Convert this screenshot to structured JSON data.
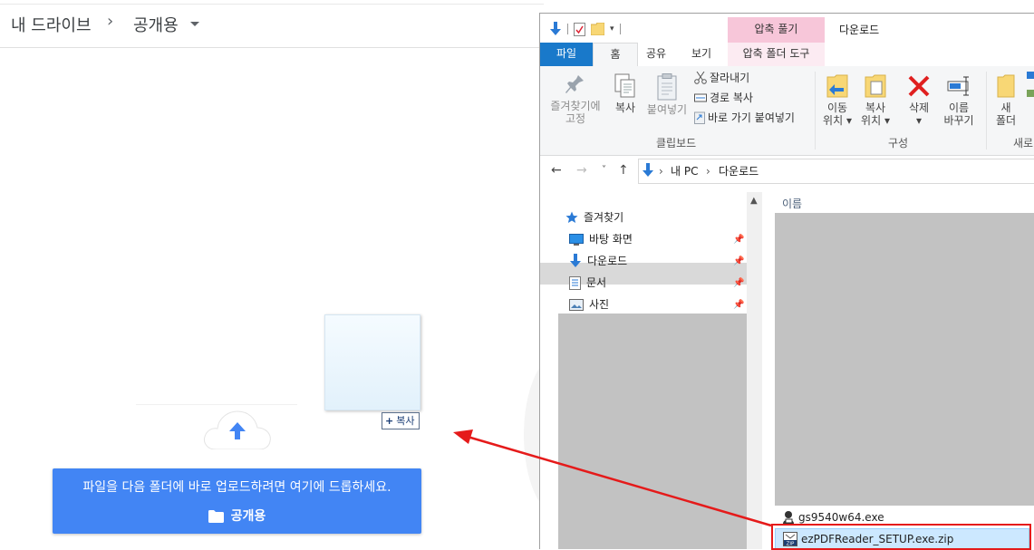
{
  "drive": {
    "breadcrumb_root": "내 드라이브",
    "breadcrumb_sep": "›",
    "breadcrumb_current": "공개용",
    "copy_badge": "복사",
    "drop_message": "파일을 다음 폴더에 바로 업로드하려면 여기에 드롭하세요.",
    "drop_folder": "공개용",
    "banner_color": "#4285f4"
  },
  "explorer": {
    "context_tab": "압축 풀기",
    "window_title": "다운로드",
    "tabs": {
      "file": "파일",
      "home": "홈",
      "share": "공유",
      "view": "보기",
      "zip_tools": "압축 폴더 도구"
    },
    "ribbon": {
      "pin_quick_line1": "즐겨찾기에",
      "pin_quick_line2": "고정",
      "copy": "복사",
      "paste": "붙여넣기",
      "cut": "잘라내기",
      "copy_path": "경로 복사",
      "paste_shortcut": "바로 가기 붙여넣기",
      "clipboard_group": "클립보드",
      "move_to_line1": "이동",
      "move_to_line2": "위치",
      "copy_to_line1": "복사",
      "copy_to_line2": "위치",
      "delete": "삭제",
      "rename_line1": "이름",
      "rename_line2": "바꾸기",
      "organize_group": "구성",
      "new_folder_line1": "새",
      "new_folder_line2": "폴더",
      "new_group": "새로"
    },
    "address": {
      "root": "내 PC",
      "sep": "›",
      "current": "다운로드"
    },
    "nav": {
      "quick_access": "즐겨찾기",
      "items": [
        "바탕 화면",
        "다운로드",
        "문서",
        "사진"
      ]
    },
    "content": {
      "column_name": "이름",
      "files": [
        "gs9540w64.exe",
        "ezPDFReader_SETUP.exe.zip"
      ]
    }
  },
  "colors": {
    "highlight_box": "#e51a1a",
    "file_tab": "#1979ca",
    "context_tab": "#f7c6d9"
  }
}
